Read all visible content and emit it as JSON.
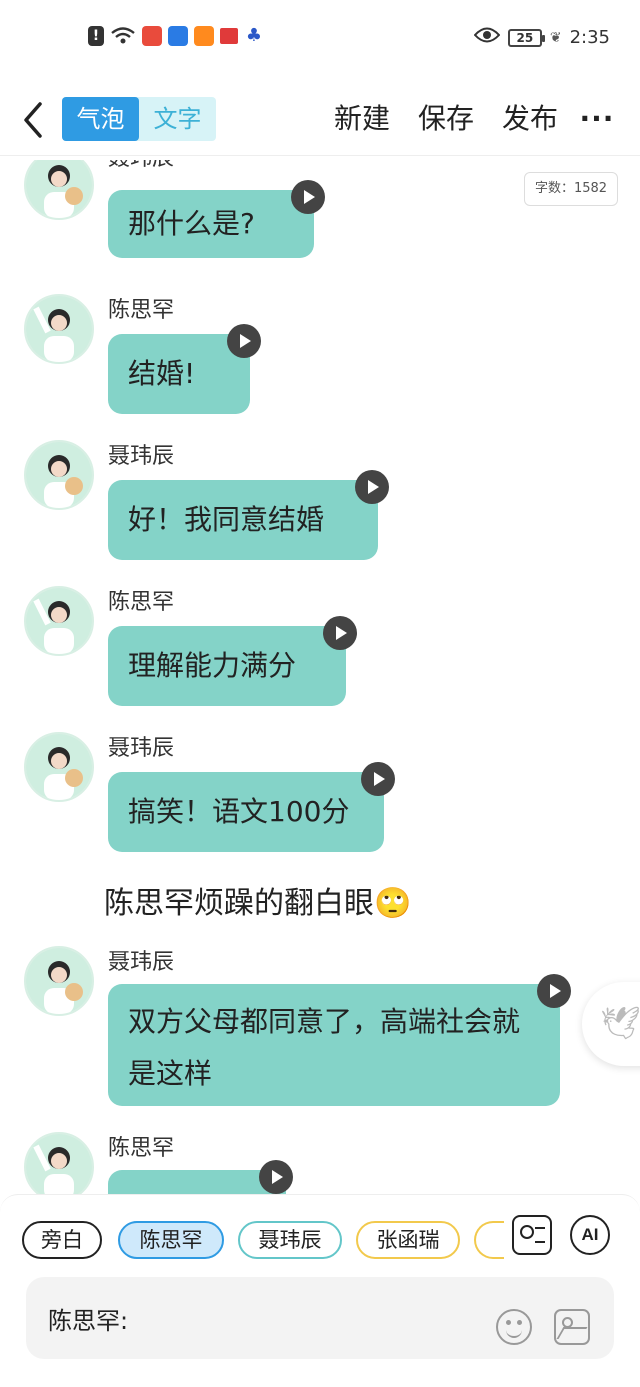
{
  "status_bar": {
    "time": "2:35",
    "battery": "25",
    "icons": [
      "alert-icon",
      "wifi-icon",
      "app-icon",
      "app-icon",
      "app-icon",
      "app-icon",
      "baidu-icon"
    ]
  },
  "top_bar": {
    "mode_bubble": "气泡",
    "mode_text": "文字",
    "new_label": "新建",
    "save_label": "保存",
    "publish_label": "发布",
    "more_label": "···"
  },
  "word_count": "字数：1582",
  "messages": [
    {
      "speaker": "聂玮辰",
      "text": "那什么是?"
    },
    {
      "speaker": "陈思罕",
      "text": "结婚!"
    },
    {
      "speaker": "聂玮辰",
      "text": "好！我同意结婚"
    },
    {
      "speaker": "陈思罕",
      "text": "理解能力满分"
    },
    {
      "speaker": "聂玮辰",
      "text": "搞笑！语文100分"
    },
    {
      "narration": "陈思罕烦躁的翻白眼🙄"
    },
    {
      "speaker": "聂玮辰",
      "text": "双方父母都同意了，高端社会就是这样"
    },
    {
      "speaker": "陈思罕",
      "text": ""
    }
  ],
  "roles": {
    "narration": "旁白",
    "chen": "陈思罕",
    "nie": "聂玮辰",
    "zhang": "张函瑞",
    "ai": "AI"
  },
  "input": {
    "label": "陈思罕:"
  },
  "colors": {
    "bubble": "#84d3c8",
    "accent": "#2f9be3"
  }
}
